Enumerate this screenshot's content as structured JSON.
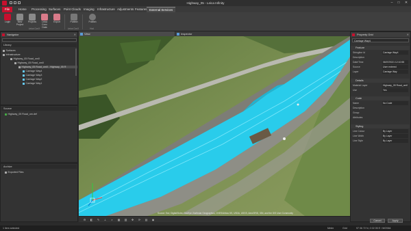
{
  "window": {
    "title": "Highway_05 - Leica Infinity"
  },
  "menu": {
    "tabs": [
      "File",
      "Home",
      "Processing",
      "Surfaces",
      "Point Clouds",
      "Imaging",
      "Infrastructure",
      "Adjustments",
      "Features",
      "External Services"
    ]
  },
  "ribbon": {
    "buttons": [
      "Login",
      "New Project",
      "Projects",
      "Leica Conx Data",
      "Export",
      "Publish",
      "Publish"
    ],
    "groups": [
      "Leica ConX",
      "Leica ConX",
      "Hxd"
    ]
  },
  "navigator": {
    "title": "Navigator",
    "library_header": "Library",
    "tree": [
      "Surfaces",
      "Infrastructure",
      "Highway_05 Road_om0",
      "Highway_05 Road_om0",
      "Highway_05 Road_om0 - Highway_05 R",
      "Carriage Way4",
      "Carriage Way3",
      "Carriage Way2",
      "Carriage Way1"
    ],
    "source_header": "Source",
    "source_item": "Highway_05 Road_om.def",
    "archive_header": "Archive",
    "archive_item": "Exported Files"
  },
  "tabs": {
    "view": "View",
    "inspector": "Inspector"
  },
  "viewport": {
    "attribution": "Source: Esri, DigitalGlobe, GeoEye, Earthstar Geographics, CNES/Airbus DS, USDA, USGS, AeroGRID, IGN, and the GIS User Community"
  },
  "property_grid": {
    "title": "Property Grid",
    "selected": "Carriage Way4",
    "sections": {
      "feature": "Feature",
      "details": "Details",
      "code": "Code",
      "styling": "Styling"
    },
    "feature_rows": [
      {
        "key": "Stringline Id",
        "value": "Carriage Way4"
      },
      {
        "key": "Description",
        "value": ""
      },
      {
        "key": "Date/Time",
        "value": "06/07/2021 12:10:55"
      },
      {
        "key": "Source",
        "value": "User entered"
      },
      {
        "key": "Layer",
        "value": "Carriage Way"
      }
    ],
    "details_rows": [
      {
        "key": "Material Layer",
        "value": "Highway_05 Road_om0"
      },
      {
        "key": "Use",
        "value": "Yes"
      }
    ],
    "code_rows": [
      {
        "key": "Name",
        "value": "No Code"
      },
      {
        "key": "Description",
        "value": ""
      },
      {
        "key": "Group",
        "value": ""
      },
      {
        "key": "Attributes",
        "value": ""
      }
    ],
    "styling_rows": [
      {
        "key": "Line Colour",
        "value": "By Layer"
      },
      {
        "key": "Line Width",
        "value": "By Layer"
      },
      {
        "key": "Line Style",
        "value": "By Layer"
      }
    ],
    "cancel": "Cancel",
    "apply": "Apply"
  },
  "status": {
    "left": "1 item selected",
    "units": "Meter",
    "zone": "Grid",
    "coords": "97 06 72 N, 0 02 05 E / WGS84"
  },
  "colors": {
    "accent": "#c8102e",
    "road_overlay": "#22d3f5",
    "panel": "#333333"
  }
}
